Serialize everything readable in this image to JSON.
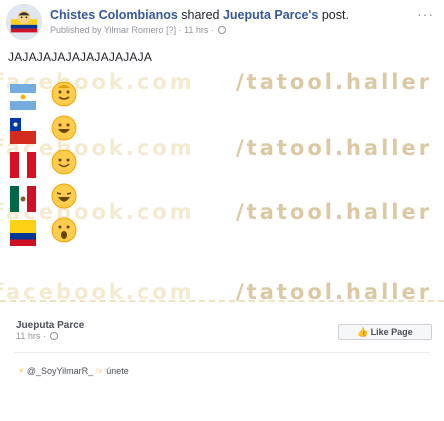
{
  "header": {
    "page_name": "Chistes Colombianos",
    "action_text": " shared ",
    "shared_from": "Jueputa Parce's",
    "post_word": " post.",
    "published_by_prefix": "Published by ",
    "publisher": "Yilmar Romero",
    "publisher_marker": " [?] · ",
    "timestamp": "11 hrs · ",
    "more_label": "···"
  },
  "post": {
    "text": "JAJAJAJAJAJAJAJAJAJA"
  },
  "image": {
    "watermark_fb": "facebook.com",
    "watermark_tt": "/tatool.haller"
  },
  "shared_card": {
    "page_name": "Jueputa Parce",
    "timestamp": "11 hrs · ",
    "like_button_label": "Like Page",
    "footer_prefix": " @_SoyYilmarR_ ",
    "footer_suffix": " únete"
  },
  "colors": {
    "link": "#365899",
    "meta": "#90949c",
    "watermark_dark": "#dac9a2",
    "watermark_light": "#f4ead0"
  }
}
